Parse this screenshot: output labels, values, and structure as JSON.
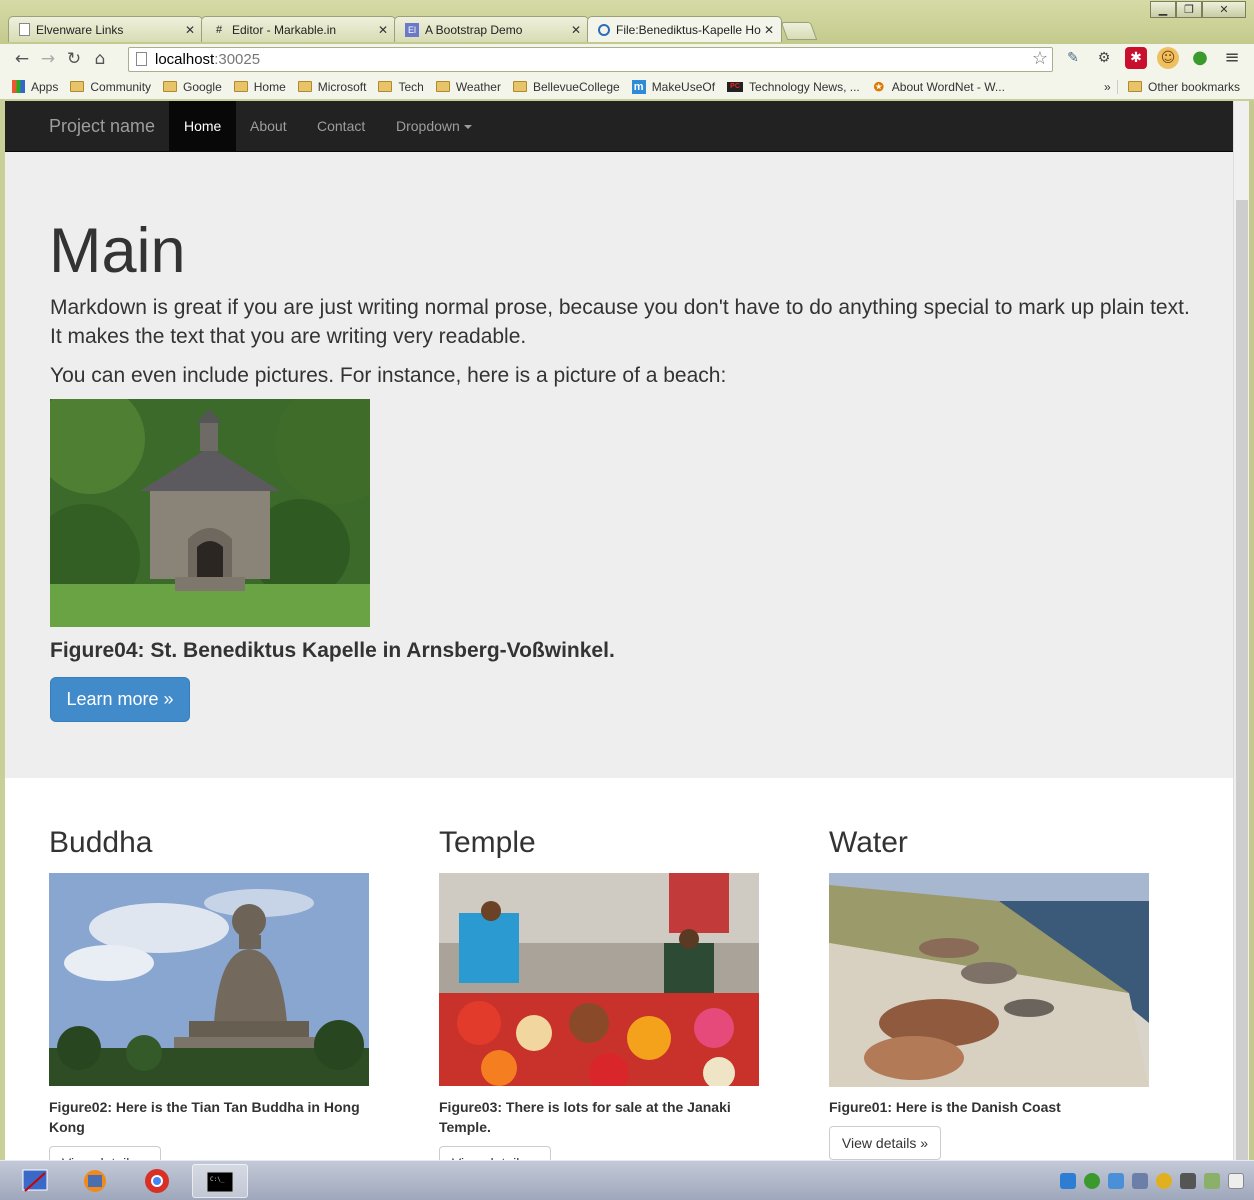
{
  "browser": {
    "tabs": [
      {
        "title": "Elvenware Links",
        "favicon": "document-icon",
        "active": false
      },
      {
        "title": "Editor - Markable.in",
        "favicon": "hash-icon",
        "active": false
      },
      {
        "title": "A Bootstrap Demo",
        "favicon": "bootstrap-icon",
        "active": false
      },
      {
        "title": "File:Benediktus-Kapelle Ho",
        "favicon": "wikimedia-icon",
        "active": true
      }
    ],
    "address": {
      "host": "localhost",
      "port": ":30025"
    },
    "bookmarks": [
      {
        "label": "Apps",
        "icon": "apps-icon"
      },
      {
        "label": "Community",
        "icon": "folder-icon"
      },
      {
        "label": "Google",
        "icon": "folder-icon"
      },
      {
        "label": "Home",
        "icon": "folder-icon"
      },
      {
        "label": "Microsoft",
        "icon": "folder-icon"
      },
      {
        "label": "Tech",
        "icon": "folder-icon"
      },
      {
        "label": "Weather",
        "icon": "folder-icon"
      },
      {
        "label": "BellevueCollege",
        "icon": "folder-icon"
      },
      {
        "label": "MakeUseOf",
        "icon": "makeuseof-icon"
      },
      {
        "label": "Technology News, ...",
        "icon": "pcmag-icon"
      },
      {
        "label": "About WordNet - W...",
        "icon": "wordnet-icon"
      }
    ],
    "bookmarks_overflow": "»",
    "other_bookmarks": "Other bookmarks"
  },
  "site": {
    "brand": "Project name",
    "nav": [
      "Home",
      "About",
      "Contact",
      "Dropdown"
    ],
    "active_nav": "Home"
  },
  "jumbotron": {
    "title": "Main",
    "paragraph1": "Markdown is great if you are just writing normal prose, because you don't have to do anything special to mark up plain text. It makes the text that you are writing very readable.",
    "paragraph2": "You can even include pictures. For instance, here is a picture of a beach:",
    "figure_caption": "Figure04: St. Benediktus Kapelle in Arnsberg-Voßwinkel.",
    "button": "Learn more »"
  },
  "columns": [
    {
      "heading": "Buddha",
      "caption": "Figure02: Here is the Tian Tan Buddha in Hong Kong",
      "button": "View details »"
    },
    {
      "heading": "Temple",
      "caption": "Figure03: There is lots for sale at the Janaki Temple.",
      "button": "View details »"
    },
    {
      "heading": "Water",
      "caption": "Figure01: Here is the Danish Coast",
      "button": "View details »"
    }
  ]
}
